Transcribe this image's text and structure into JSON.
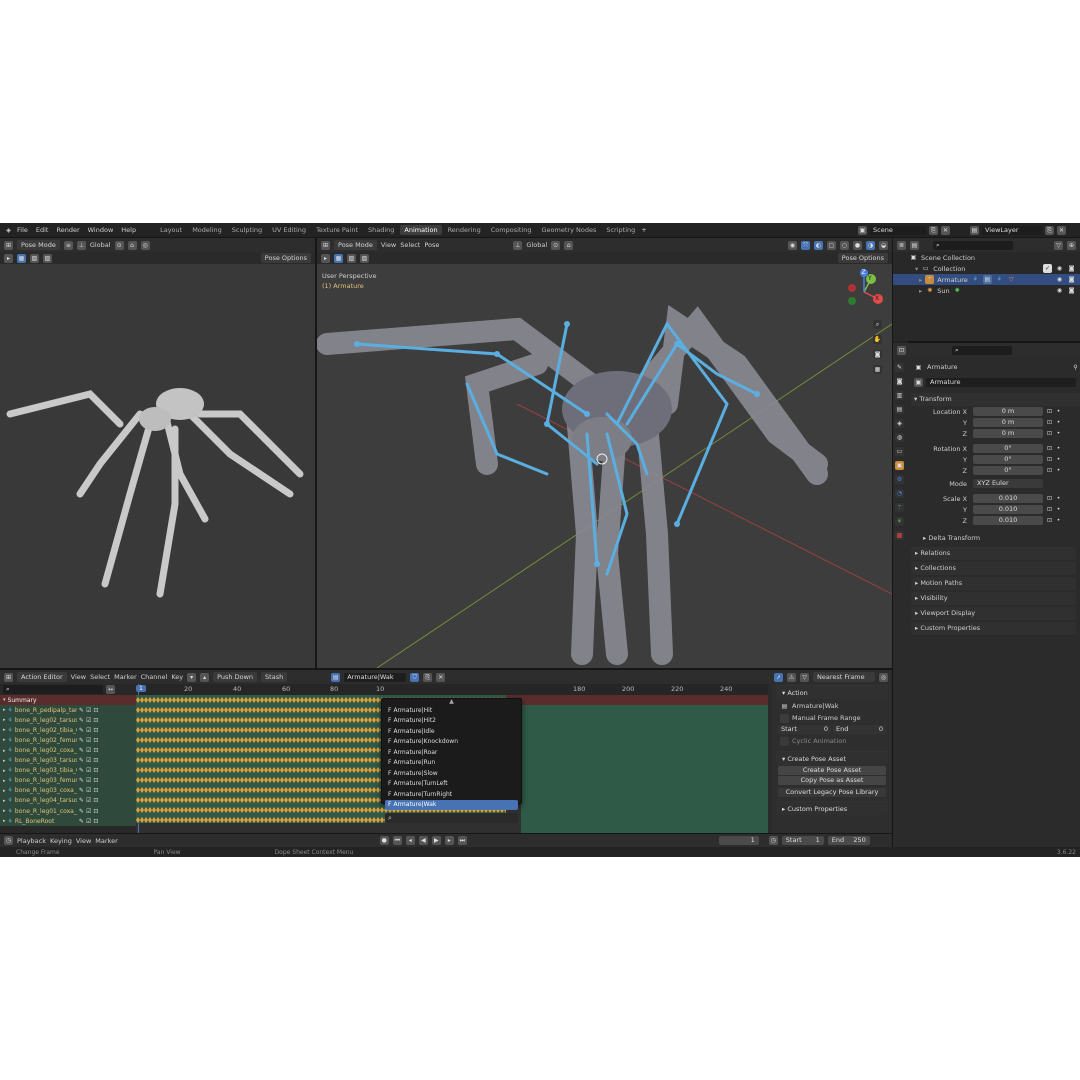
{
  "menu": {
    "items": [
      "File",
      "Edit",
      "Render",
      "Window",
      "Help"
    ]
  },
  "workspaces": {
    "tabs": [
      "Layout",
      "Modeling",
      "Sculpting",
      "UV Editing",
      "Texture Paint",
      "Shading",
      "Animation",
      "Rendering",
      "Compositing",
      "Geometry Nodes",
      "Scripting"
    ],
    "add": "+",
    "active": "Animation"
  },
  "scene": {
    "name": "Scene",
    "view_layer": "ViewLayer"
  },
  "left_view": {
    "mode": "Pose Mode",
    "orientation": "Global",
    "pose_options": "Pose Options"
  },
  "main_view": {
    "mode": "Pose Mode",
    "menus": [
      "View",
      "Select",
      "Pose"
    ],
    "orientation": "Global",
    "pose_options": "Pose Options",
    "overlay_title": "User Perspective",
    "overlay_object": "(1) Armature",
    "gizmo": {
      "x": "X",
      "y": "Y",
      "z": "Z"
    }
  },
  "outliner": {
    "root": "Scene Collection",
    "collection": "Collection",
    "items": [
      {
        "name": "Armature"
      },
      {
        "name": "Sun"
      }
    ]
  },
  "properties": {
    "object_name": "Armature",
    "data_name": "Armature",
    "transform_label": "Transform",
    "location": {
      "label": "Location X",
      "y": "Y",
      "z": "Z",
      "values": [
        "0 m",
        "0 m",
        "0 m"
      ]
    },
    "rotation": {
      "label": "Rotation X",
      "y": "Y",
      "z": "Z",
      "values": [
        "0°",
        "0°",
        "0°"
      ]
    },
    "mode": {
      "label": "Mode",
      "value": "XYZ Euler"
    },
    "scale": {
      "label": "Scale X",
      "y": "Y",
      "z": "Z",
      "values": [
        "0.010",
        "0.010",
        "0.010"
      ]
    },
    "delta": "Delta Transform",
    "sections": [
      "Relations",
      "Collections",
      "Motion Paths",
      "Visibility",
      "Viewport Display",
      "Custom Properties"
    ]
  },
  "action_editor": {
    "mode": "Action Editor",
    "menus": [
      "View",
      "Select",
      "Marker",
      "Channel",
      "Key"
    ],
    "push_down": "Push Down",
    "stash": "Stash",
    "action": "Armature|Wak",
    "snap": "Nearest Frame",
    "current_frame_label": "1",
    "ruler": [
      "20",
      "40",
      "60",
      "80",
      "10",
      "180",
      "200",
      "220",
      "240"
    ],
    "channels": [
      "Summary",
      "bone_R_pedipalp_tarsus_",
      "bone_R_leg02_tarsus_",
      "bone_R_leg02_tibia_0",
      "bone_R_leg02_femur_",
      "bone_R_leg02_coxa_0",
      "bone_R_leg03_tarsus_",
      "bone_R_leg03_tibia_0",
      "bone_R_leg03_femur_",
      "bone_R_leg03_coxa_0",
      "bone_R_leg04_tarsus_",
      "bone_R_leg01_coxa_0",
      "RL_BoneRoot"
    ],
    "dropdown": {
      "items": [
        "Armature|Hit",
        "Armature|Hit2",
        "Armature|Idle",
        "Armature|Knockdown",
        "Armature|Roar",
        "Armature|Run",
        "Armature|Slow",
        "Armature|TurnLeft",
        "Armature|TurnRight",
        "Armature|Wak"
      ],
      "prefix": "F",
      "selected": 9
    }
  },
  "side_panel": {
    "action_hdr": "Action",
    "action_name": "Armature|Wak",
    "manual": "Manual Frame Range",
    "start": "Start",
    "start_val": "0",
    "end": "End",
    "end_val": "0",
    "cyclic": "Cyclic Animation",
    "pose_hdr": "Create Pose Asset",
    "create_pose": "Create Pose Asset",
    "copy_pose": "Copy Pose as Asset",
    "convert": "Convert Legacy Pose Library",
    "custom": "Custom Properties"
  },
  "timeline": {
    "menus": [
      "Playback",
      "Keying",
      "View",
      "Marker"
    ],
    "frame": "1",
    "start_label": "Start",
    "start": "1",
    "end_label": "End",
    "end": "250"
  },
  "status": {
    "left": "Change Frame",
    "mid": "Pan View",
    "right": "Dope Sheet Context Menu",
    "version": "3.6.22"
  },
  "colors": {
    "accent": "#4772b3",
    "bone": "#5aaee0",
    "key": "#e3a13a",
    "green_channel": "#2f5a48"
  }
}
